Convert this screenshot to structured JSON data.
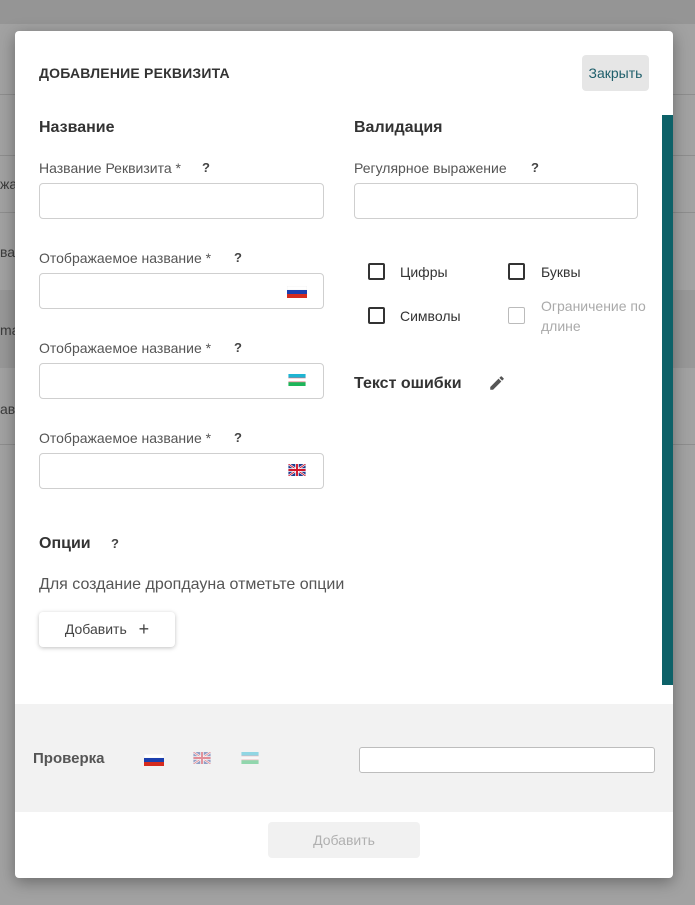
{
  "background": {
    "row_texts": [
      "жа",
      "ва",
      "ma",
      "ав"
    ]
  },
  "modal": {
    "title": "ДОБАВЛЕНИЕ РЕКВИЗИТА",
    "close_label": "Закрыть",
    "accent_color": "#0d6168",
    "left": {
      "section_title": "Название",
      "name_label": "Название Реквизита *",
      "display_label_ru": "Отображаемое название *",
      "display_label_uz": "Отображаемое название *",
      "display_label_en": "Отображаемое название *",
      "help": "?",
      "name_value": "",
      "display_value_ru": "",
      "display_value_uz": "",
      "display_value_en": "",
      "flags": [
        "flag-ru-icon",
        "flag-uz-icon",
        "flag-gb-icon"
      ]
    },
    "validation": {
      "section_title": "Валидация",
      "regex_label": "Регулярное выражение",
      "help": "?",
      "regex_value": "",
      "checkboxes": [
        {
          "label": "Цифры",
          "checked": false,
          "disabled": false
        },
        {
          "label": "Буквы",
          "checked": false,
          "disabled": false
        },
        {
          "label": "Символы",
          "checked": false,
          "disabled": false
        },
        {
          "label": "Ограничение по длине",
          "checked": false,
          "disabled": true
        }
      ],
      "error_text_title": "Текст ошибки"
    },
    "options": {
      "title": "Опции",
      "help": "?",
      "description": "Для создание дропдауна отметьте опции",
      "add_label": "Добавить",
      "add_icon": "plus-icon"
    },
    "check": {
      "label": "Проверка",
      "flags": [
        "flag-ru-icon",
        "flag-gb-icon",
        "flag-uz-icon"
      ],
      "value": ""
    },
    "submit_label": "Добавить"
  }
}
